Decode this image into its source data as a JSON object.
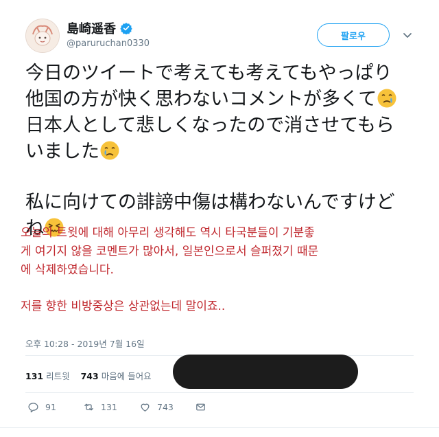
{
  "user": {
    "name": "島崎遥香",
    "handle": "@paruruchan0330",
    "follow_label": "팔로우"
  },
  "tweet": {
    "jp_lines": [
      "今日のツイートで考えても考えてもやっぱり",
      "他国の方が快く思わないコメントが多くて",
      "日本人として悲しくなったので消させてもら",
      "いました"
    ],
    "jp_line2": [
      "私に向けての誹謗中傷は構わないんですけど",
      "ね"
    ]
  },
  "translation": {
    "para1_lines": [
      "오늘의 트윗에 대해 아무리 생각해도 역시 타국분들이 기분좋",
      "게 여기지 않을 코멘트가 많아서, 일본인으로서 슬퍼졌기 때문",
      "에 삭제하였습니다."
    ],
    "para2": "저를 향한 비방중상은 상관없는데 말이죠.."
  },
  "meta": {
    "timestamp": "오후 10:28 - 2019년 7월 16일",
    "retweets_count": "131",
    "retweets_label": "리트윗",
    "likes_count": "743",
    "likes_label": "마음에 들어요"
  },
  "actions": {
    "reply_count": "91",
    "retweet_count": "131",
    "like_count": "743"
  },
  "icons": {
    "verified": "verified-badge-icon",
    "caret": "chevron-down-icon",
    "reply": "reply-icon",
    "retweet": "retweet-icon",
    "like": "heart-icon",
    "dm": "envelope-icon"
  },
  "colors": {
    "accent": "#1da1f2",
    "translation_text": "#c0272d",
    "muted": "#657786"
  }
}
